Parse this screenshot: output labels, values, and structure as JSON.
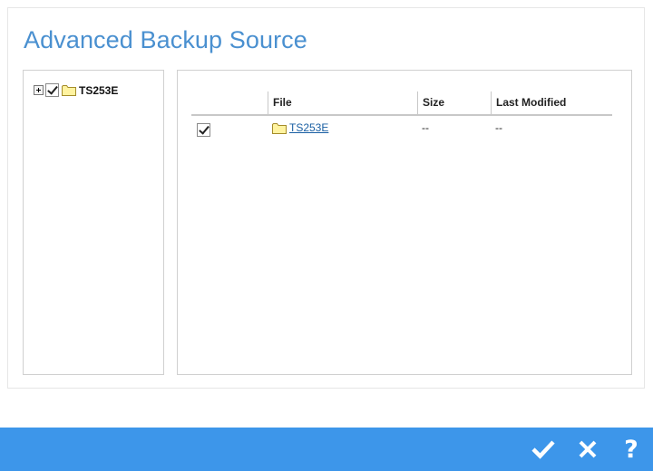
{
  "dialog": {
    "title": "Advanced Backup Source"
  },
  "tree": {
    "nodes": [
      {
        "label": "TS253E",
        "checked": true,
        "expanded": false
      }
    ]
  },
  "file_table": {
    "columns": [
      "File",
      "Size",
      "Last Modified"
    ],
    "rows": [
      {
        "file": "TS253E",
        "size": "--",
        "last_modified": "--",
        "checked": true
      }
    ]
  },
  "footer": {
    "help_label": "?"
  },
  "colors": {
    "title": "#4a90d0",
    "footer": "#3d96ea",
    "link": "#1a5fa3",
    "folder": "#fff3a0"
  }
}
